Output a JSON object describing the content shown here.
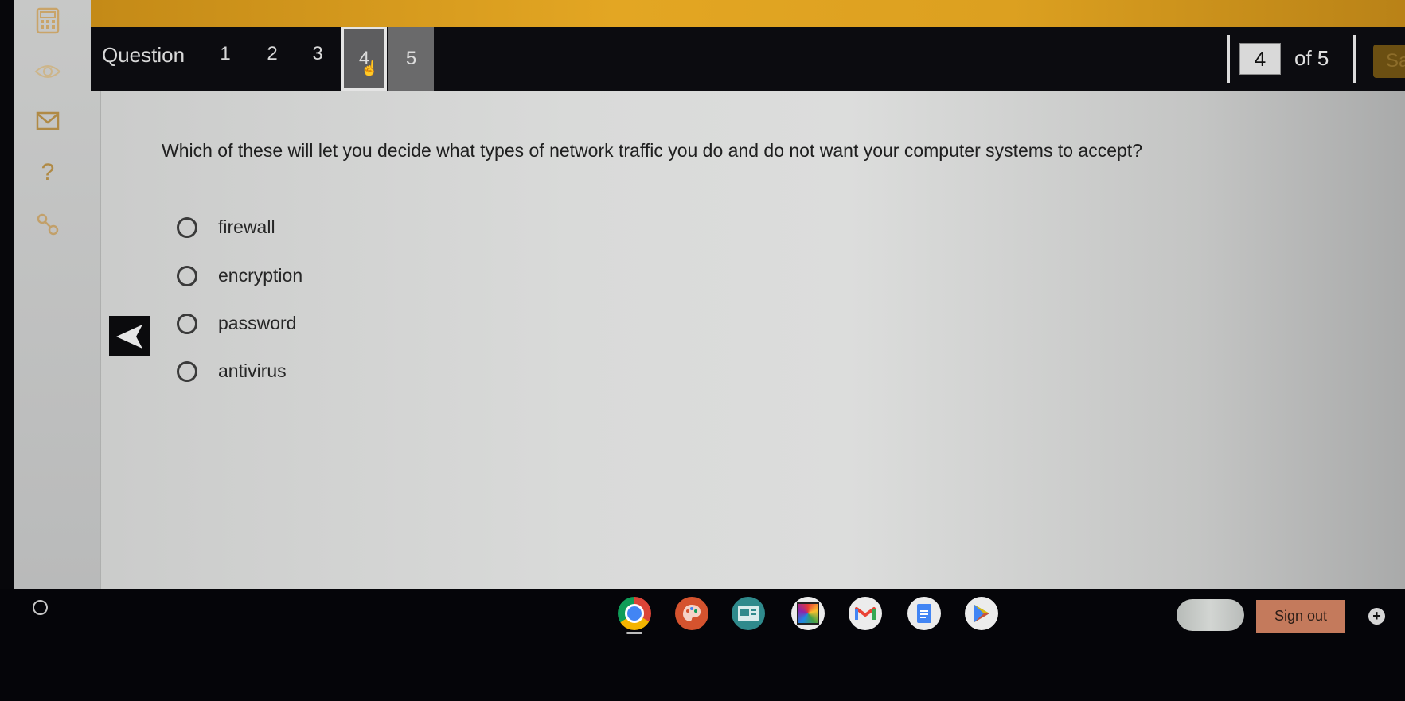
{
  "sidebar": {
    "icons": [
      {
        "name": "calculator-icon"
      },
      {
        "name": "eye-icon"
      },
      {
        "name": "mail-icon"
      },
      {
        "name": "help-icon",
        "glyph": "?"
      },
      {
        "name": "key-icon"
      }
    ]
  },
  "navigator": {
    "label": "Question",
    "numbers": [
      "1",
      "2",
      "3",
      "4",
      "5"
    ],
    "current": "4",
    "page_input_value": "4",
    "of_text": "of 5",
    "save_label": "Sa"
  },
  "question": {
    "text": "Which of these will let you decide what types of network traffic you do and do not want your computer systems to accept?",
    "options": [
      "firewall",
      "encryption",
      "password",
      "antivirus"
    ],
    "selected": null
  },
  "shelf": {
    "apps": [
      {
        "name": "chrome",
        "color": "#ffffff"
      },
      {
        "name": "paint",
        "color": "#d5532e"
      },
      {
        "name": "classroom",
        "color": "#2f8a8c"
      },
      {
        "name": "photo-app",
        "color": "#e8e8e8"
      },
      {
        "name": "gmail",
        "color": "#e8e8e8"
      },
      {
        "name": "docs",
        "color": "#e8e8e8"
      },
      {
        "name": "play-store",
        "color": "#e8e8e8"
      }
    ],
    "signout_label": "Sign out",
    "plus_glyph": "+"
  },
  "colors": {
    "accent_strip": "#e3a623",
    "navbar": "#0c0c10",
    "signout": "#c47a5c"
  }
}
